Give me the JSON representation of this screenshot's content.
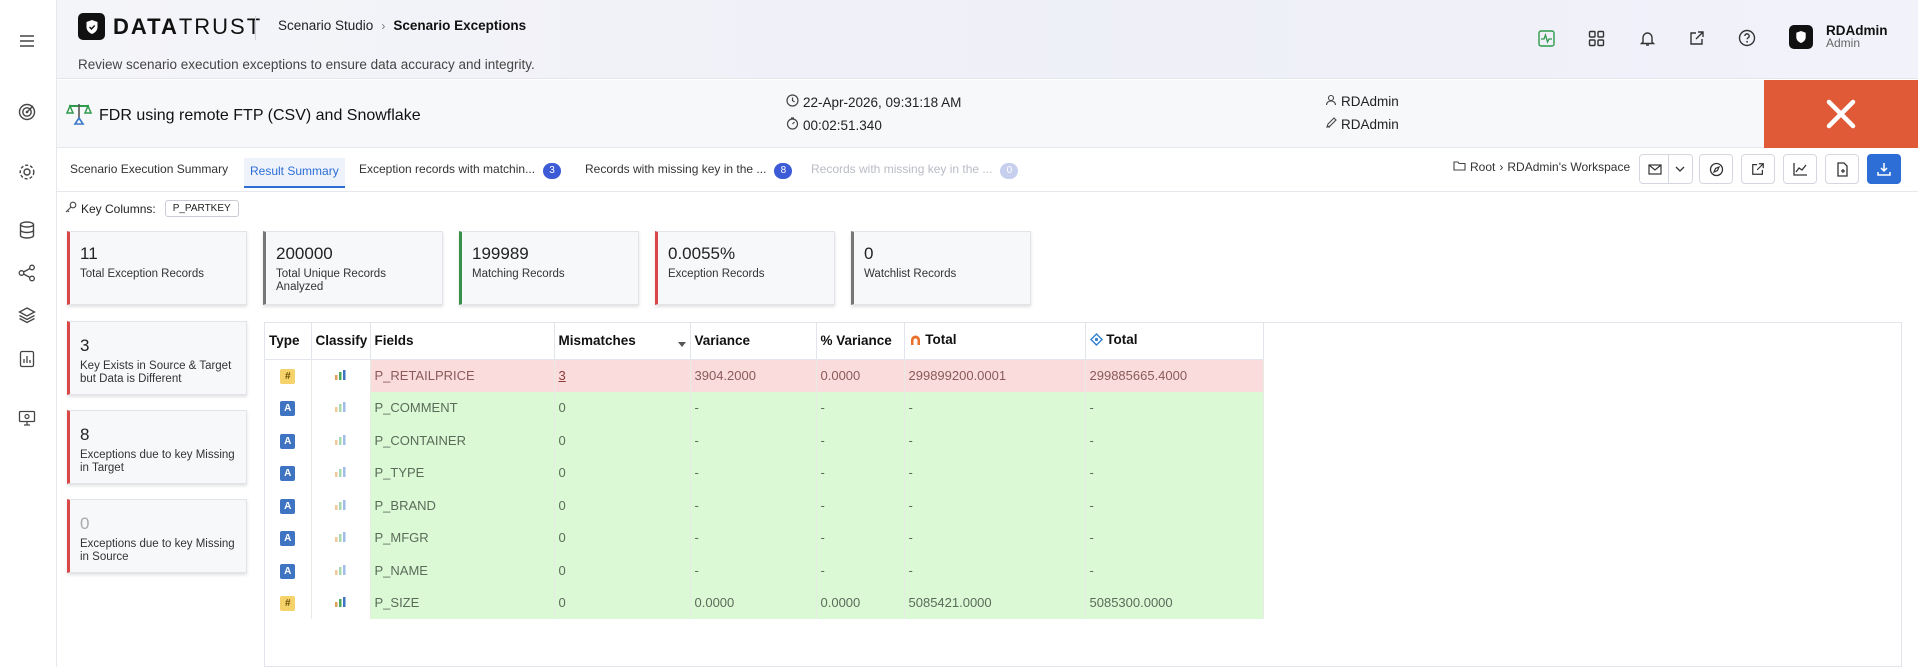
{
  "app": {
    "logo_bold": "DATA",
    "logo_thin": "TRUST",
    "breadcrumb": [
      "Scenario Studio",
      "Scenario Exceptions"
    ],
    "subtitle": "Review scenario execution exceptions to ensure data accuracy and integrity."
  },
  "user": {
    "name": "RDAdmin",
    "role": "Admin"
  },
  "scenario": {
    "title": "FDR using remote FTP (CSV) and Snowflake",
    "datetime": "22-Apr-2026, 09:31:18 AM",
    "duration": "00:02:51.340",
    "created_by": "RDAdmin",
    "edited_by": "RDAdmin"
  },
  "tabs": [
    {
      "label": "Scenario Execution Summary",
      "count": ""
    },
    {
      "label": "Result Summary",
      "count": ""
    },
    {
      "label": "Exception records with matchin...",
      "count": "3"
    },
    {
      "label": "Records with missing key in the ...",
      "count": "8"
    },
    {
      "label": "Records with missing key in the ...",
      "count": "0"
    }
  ],
  "workspace": {
    "root": "Root",
    "name": "RDAdmin's Workspace"
  },
  "key_columns": {
    "label": "Key Columns:",
    "value": "P_PARTKEY"
  },
  "summary_cards": [
    {
      "value": "11",
      "label": "Total Exception Records"
    },
    {
      "value": "200000",
      "label": "Total Unique Records Analyzed"
    },
    {
      "value": "199989",
      "label": "Matching Records"
    },
    {
      "value": "0.0055%",
      "label": "Exception Records"
    },
    {
      "value": "0",
      "label": "Watchlist Records"
    }
  ],
  "side_cards": [
    {
      "value": "3",
      "label": "Key Exists in Source & Target but Data is Different"
    },
    {
      "value": "8",
      "label": "Exceptions due to key Missing in Target"
    },
    {
      "value": "0",
      "label": "Exceptions due to key Missing in Source"
    }
  ],
  "table": {
    "headers": [
      "Type",
      "Classify",
      "Fields",
      "Mismatches",
      "Variance",
      "% Variance",
      "Total",
      "Total"
    ],
    "rows": [
      {
        "type": "#",
        "field": "P_RETAILPRICE",
        "mismatches": "3",
        "variance": "3904.2000",
        "pct": "0.0000",
        "total_src": "299899200.0001",
        "total_tgt": "299885665.4000",
        "status": "bad"
      },
      {
        "type": "A",
        "field": "P_COMMENT",
        "mismatches": "0",
        "variance": "-",
        "pct": "-",
        "total_src": "-",
        "total_tgt": "-",
        "status": "ok"
      },
      {
        "type": "A",
        "field": "P_CONTAINER",
        "mismatches": "0",
        "variance": "-",
        "pct": "-",
        "total_src": "-",
        "total_tgt": "-",
        "status": "ok"
      },
      {
        "type": "A",
        "field": "P_TYPE",
        "mismatches": "0",
        "variance": "-",
        "pct": "-",
        "total_src": "-",
        "total_tgt": "-",
        "status": "ok"
      },
      {
        "type": "A",
        "field": "P_BRAND",
        "mismatches": "0",
        "variance": "-",
        "pct": "-",
        "total_src": "-",
        "total_tgt": "-",
        "status": "ok"
      },
      {
        "type": "A",
        "field": "P_MFGR",
        "mismatches": "0",
        "variance": "-",
        "pct": "-",
        "total_src": "-",
        "total_tgt": "-",
        "status": "ok"
      },
      {
        "type": "A",
        "field": "P_NAME",
        "mismatches": "0",
        "variance": "-",
        "pct": "-",
        "total_src": "-",
        "total_tgt": "-",
        "status": "ok"
      },
      {
        "type": "#",
        "field": "P_SIZE",
        "mismatches": "0",
        "variance": "0.0000",
        "pct": "0.0000",
        "total_src": "5085421.0000",
        "total_tgt": "5085300.0000",
        "status": "ok"
      }
    ]
  },
  "colors": {
    "accent": "#2c6ed5",
    "close": "#e05a38",
    "row_mismatch": "#fbdcdc",
    "row_match": "#dcf9d5"
  }
}
